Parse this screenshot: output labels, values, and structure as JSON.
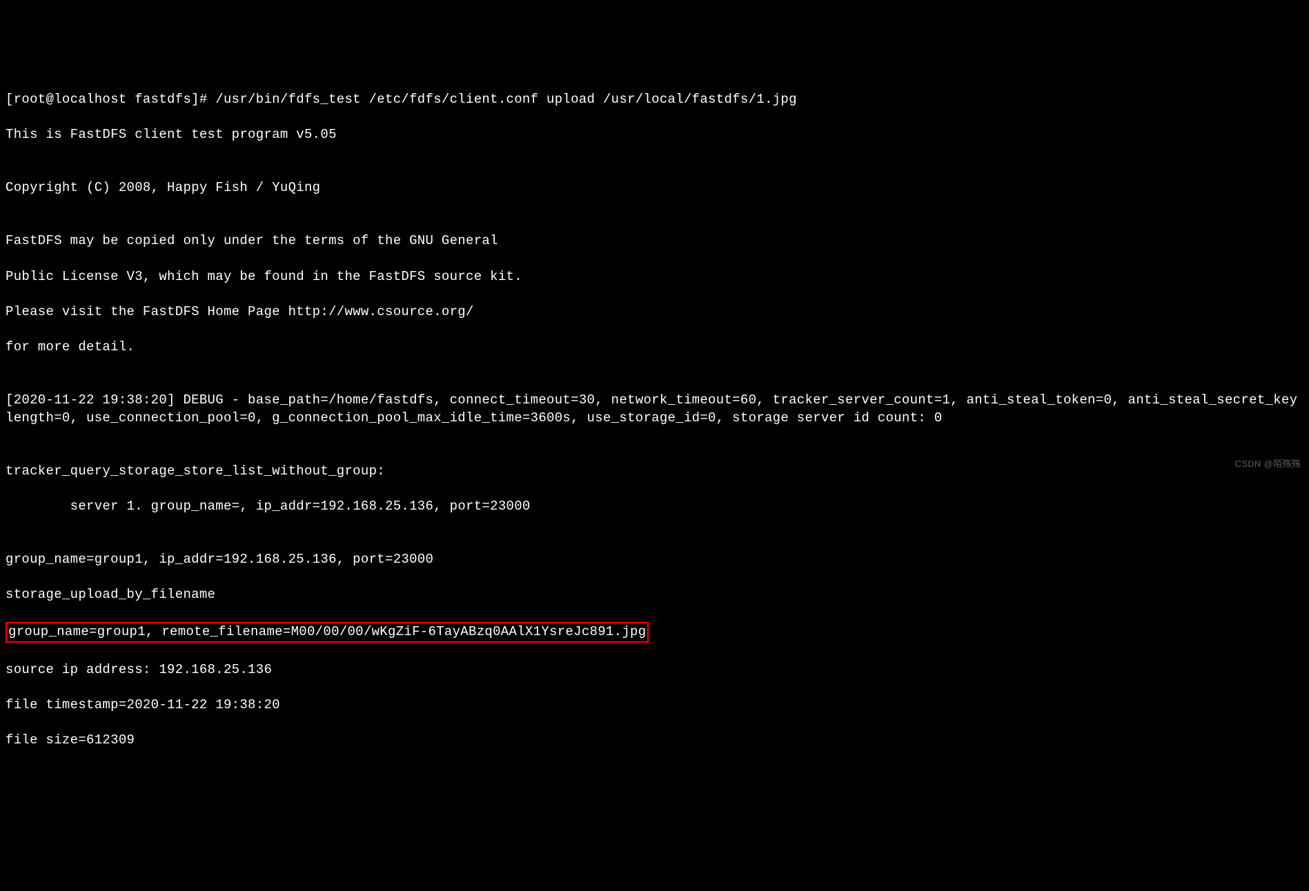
{
  "terminal": {
    "prompt": "[root@localhost fastdfs]# ",
    "command": "/usr/bin/fdfs_test /etc/fdfs/client.conf upload /usr/local/fastdfs/1.jpg",
    "line_program": "This is FastDFS client test program v5.05",
    "line_blank1": "",
    "line_copyright": "Copyright (C) 2008, Happy Fish / YuQing",
    "line_blank2": "",
    "line_gnu1": "FastDFS may be copied only under the terms of the GNU General",
    "line_gnu2": "Public License V3, which may be found in the FastDFS source kit.",
    "line_visit": "Please visit the FastDFS Home Page http://www.csource.org/",
    "line_detail": "for more detail.",
    "line_blank3": "",
    "line_debug": "[2020-11-22 19:38:20] DEBUG - base_path=/home/fastdfs, connect_timeout=30, network_timeout=60, tracker_server_count=1, anti_steal_token=0, anti_steal_secret_key length=0, use_connection_pool=0, g_connection_pool_max_idle_time=3600s, use_storage_id=0, storage server id count: 0",
    "line_blank4": "",
    "line_tracker_header": "tracker_query_storage_store_list_without_group:",
    "line_tracker_server": "        server 1. group_name=, ip_addr=192.168.25.136, port=23000",
    "line_blank5": "",
    "line_group_info": "group_name=group1, ip_addr=192.168.25.136, port=23000",
    "line_storage_upload": "storage_upload_by_filename",
    "line_highlight": "group_name=group1, remote_filename=M00/00/00/wKgZiF-6TayABzq0AAlX1YsreJc891.jpg",
    "line_source_ip": "source ip address: 192.168.25.136",
    "line_timestamp": "file timestamp=2020-11-22 19:38:20",
    "line_filesize": "file size=612309"
  },
  "watermark": "CSDN @陌殇殇"
}
